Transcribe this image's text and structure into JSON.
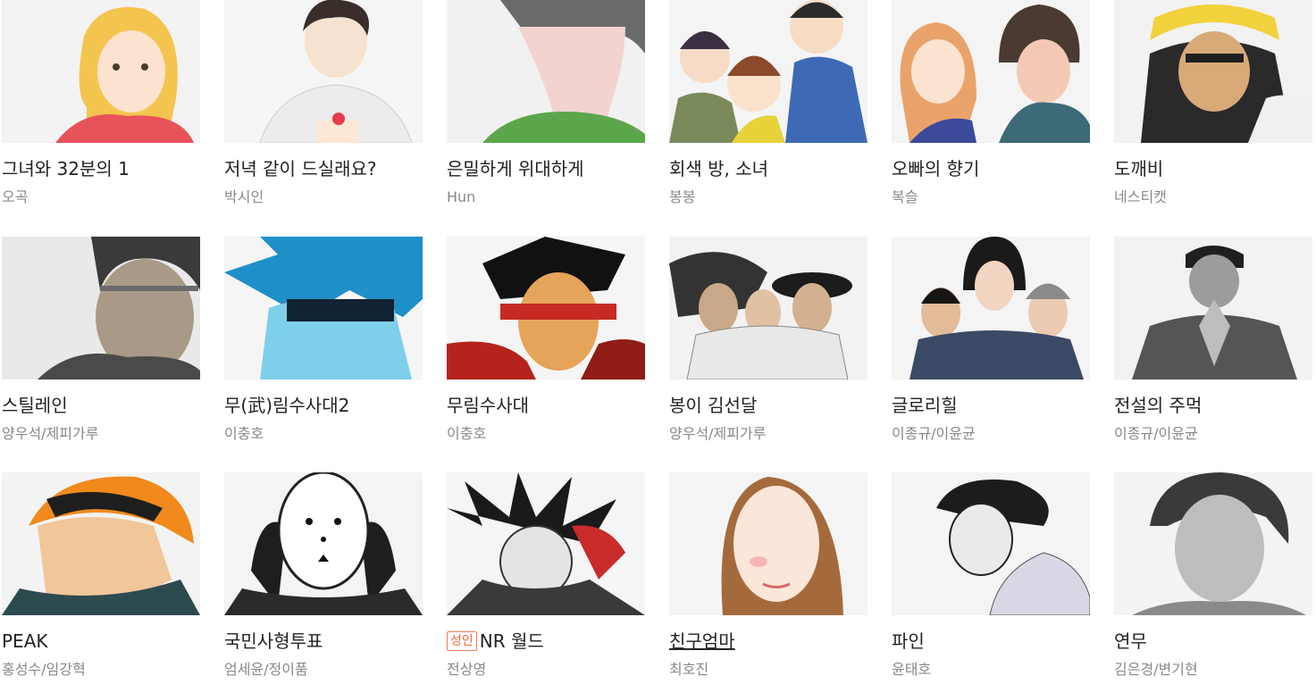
{
  "badge_label": "성인",
  "rows": [
    [
      {
        "title": "그녀와 32분의 1",
        "author": "오곡"
      },
      {
        "title": "저녁 같이 드실래요?",
        "author": "박시인"
      },
      {
        "title": "은밀하게 위대하게",
        "author": "Hun"
      },
      {
        "title": "회색 방, 소녀",
        "author": "봉봉"
      },
      {
        "title": "오빠의 향기",
        "author": "복슬"
      },
      {
        "title": "도깨비",
        "author": "네스티캣"
      }
    ],
    [
      {
        "title": "스틸레인",
        "author": "양우석/제피가루"
      },
      {
        "title": "무(武)림수사대2",
        "author": "이충호"
      },
      {
        "title": "무림수사대",
        "author": "이충호"
      },
      {
        "title": "봉이 김선달",
        "author": "양우석/제피가루"
      },
      {
        "title": "글로리힐",
        "author": "이종규/이윤균"
      },
      {
        "title": "전설의 주먹",
        "author": "이종규/이윤균"
      }
    ],
    [
      {
        "title": "PEAK",
        "author": "홍성수/임강혁"
      },
      {
        "title": "국민사형투표",
        "author": "엄세윤/정이품"
      },
      {
        "title": "NR 월드",
        "author": "전상영"
      },
      {
        "title": "친구엄마",
        "author": "최호진"
      },
      {
        "title": "파인",
        "author": "윤태호"
      },
      {
        "title": "연무",
        "author": "김은경/변기현"
      }
    ]
  ]
}
